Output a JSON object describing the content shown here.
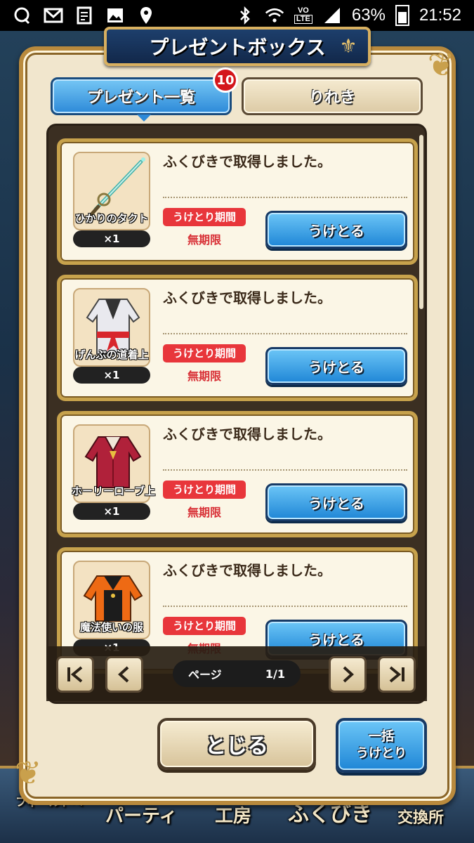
{
  "status_bar": {
    "vo_label": "VO",
    "lte_label": "LTE",
    "battery": "63%",
    "time": "21:52"
  },
  "dialog": {
    "title": "プレゼントボックス",
    "tabs": [
      {
        "label": "プレゼント一覧",
        "active": true
      },
      {
        "label": "りれき",
        "active": false
      }
    ],
    "badge_count": "10"
  },
  "presents": [
    {
      "item_name": "ひかりのタクト",
      "quantity": "×1",
      "message": "ふくびきで取得しました。",
      "period_label": "うけとり期間",
      "period_value": "無期限",
      "receive_label": "うけとる"
    },
    {
      "item_name": "げんぶの道着上",
      "quantity": "×1",
      "message": "ふくびきで取得しました。",
      "period_label": "うけとり期間",
      "period_value": "無期限",
      "receive_label": "うけとる"
    },
    {
      "item_name": "ホーリーローブ上",
      "quantity": "×1",
      "message": "ふくびきで取得しました。",
      "period_label": "うけとり期間",
      "period_value": "無期限",
      "receive_label": "うけとる"
    },
    {
      "item_name": "魔法使いの服",
      "quantity": "×1",
      "message": "ふくびきで取得しました。",
      "period_label": "うけとり期間",
      "period_value": "無期限",
      "receive_label": "うけとる"
    }
  ],
  "pager": {
    "page_label": "ページ",
    "page_value": "1/1"
  },
  "buttons": {
    "close": "とじる",
    "bulk_line1": "一括",
    "bulk_line2": "うけとり"
  },
  "bottom_nav": [
    "フィールドへ",
    "パーティ",
    "工房",
    "ふくびき",
    "交換所"
  ],
  "icons": {
    "message": "message-icon",
    "gmail": "mail-icon",
    "news": "news-icon",
    "gallery": "image-icon",
    "location": "location-icon",
    "bluetooth": "bluetooth-icon",
    "wifi": "wifi-icon",
    "signal": "signal-icon",
    "battery": "battery-icon"
  },
  "colors": {
    "accent_blue": "#2c89d8",
    "badge_red": "#d4161c",
    "period_red": "#e8363b",
    "frame_gold": "#c7a24c"
  }
}
